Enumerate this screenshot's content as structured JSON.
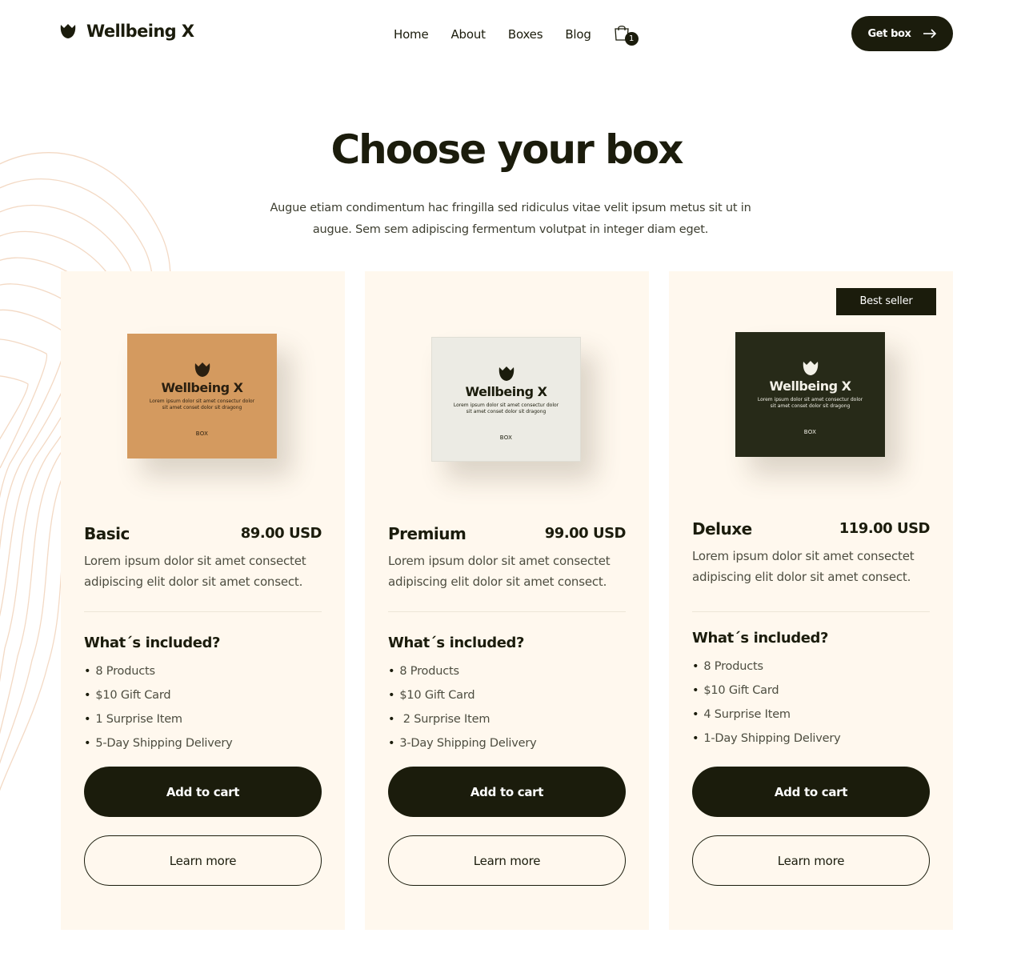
{
  "nav": {
    "brand": "Wellbeing X",
    "brand_icon": "tulip-logo-icon",
    "menu": [
      "Home",
      "About",
      "Boxes",
      "Blog"
    ],
    "cart_icon": "shopping-bag-icon",
    "cart_count": "1",
    "cta_label": "Get box",
    "cta_icon": "arrow-right-icon"
  },
  "hero": {
    "title": "Choose your box",
    "subtitle": "Augue etiam condimentum hac fringilla sed ridiculus vitae velit ipsum metus sit ut in augue. Sem sem adipiscing fermentum volutpat in integer diam eget."
  },
  "box_art": {
    "name": "Wellbeing X",
    "text": "Lorem ipsum dolor sit amet consectur dolor sit amet conset dolor sit dragong",
    "label": "BOX"
  },
  "plans": [
    {
      "name": "Basic",
      "price": "89.00 USD",
      "description": "Lorem ipsum dolor sit amet consectet adipiscing elit dolor sit amet consect.",
      "included_title": "What´s included?",
      "features": [
        "8 Products",
        "$10 Gift Card",
        "1  Surprise Item",
        "5-Day Shipping Delivery"
      ],
      "add_label": "Add to cart",
      "learn_label": "Learn more",
      "box_color": "#d49a5f"
    },
    {
      "name": "Premium",
      "price": "99.00 USD",
      "description": "Lorem ipsum dolor sit amet consectet adipiscing elit dolor sit amet consect.",
      "included_title": "What´s included?",
      "features": [
        "8 Products",
        "$10 Gift Card",
        " 2 Surprise Item",
        "3-Day Shipping Delivery"
      ],
      "add_label": "Add to cart",
      "learn_label": "Learn more",
      "box_color": "#ecebe4"
    },
    {
      "name": "Deluxe",
      "price": "119.00 USD",
      "badge": "Best seller",
      "description": "Lorem ipsum dolor sit amet consectet adipiscing elit dolor sit amet consect.",
      "included_title": "What´s included?",
      "features": [
        "8 Products",
        "$10 Gift Card",
        "4 Surprise Item",
        "1-Day Shipping Delivery"
      ],
      "add_label": "Add to cart",
      "learn_label": "Learn more",
      "box_color": "#272a18"
    }
  ],
  "colors": {
    "primary": "#1b1c0c",
    "card_bg": "#fff8ee",
    "topo_lines": "#f3d9c4"
  }
}
